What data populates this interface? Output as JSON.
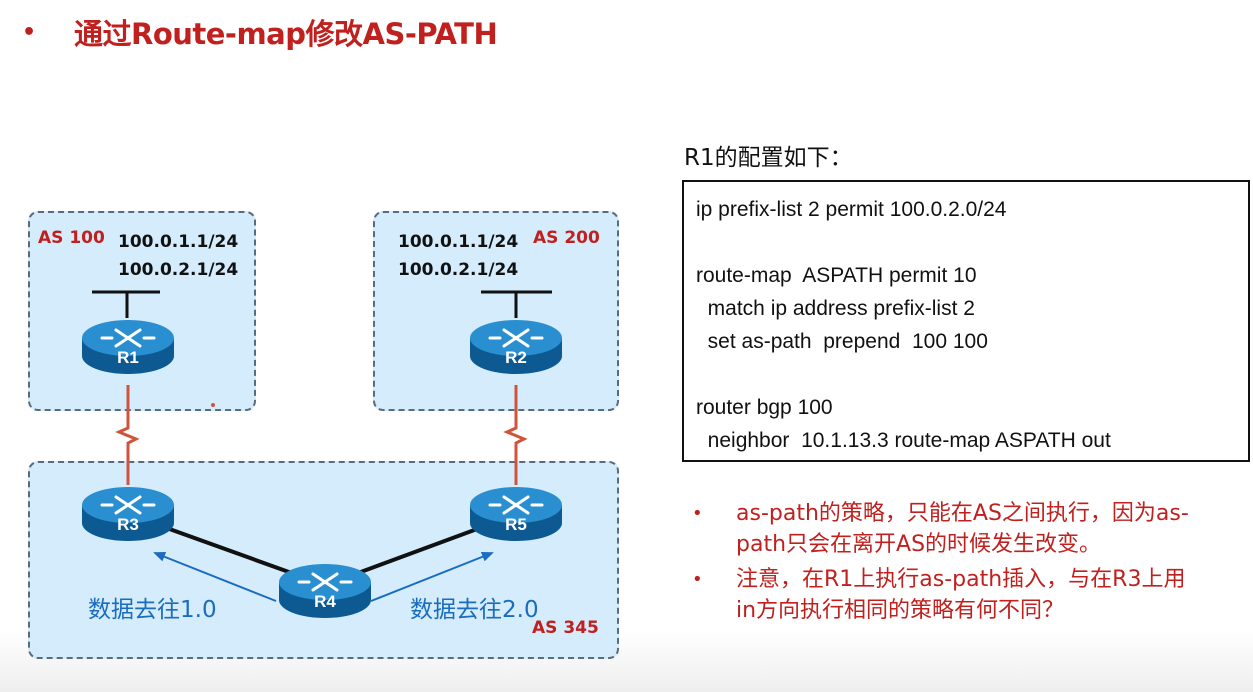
{
  "title": {
    "bullet": "•",
    "text": "通过Route-map修改AS-PATH"
  },
  "diagram": {
    "as_boxes": [
      {
        "id": "as100",
        "label": "AS 100",
        "addresses": [
          "100.0.1.1/24",
          "100.0.2.1/24"
        ]
      },
      {
        "id": "as200",
        "label": "AS 200",
        "addresses": [
          "100.0.1.1/24",
          "100.0.2.1/24"
        ]
      },
      {
        "id": "as345",
        "label": "AS 345"
      }
    ],
    "routers": [
      "R1",
      "R2",
      "R3",
      "R4",
      "R5"
    ],
    "flows": [
      "数据去往1.0",
      "数据去往2.0"
    ],
    "colors": {
      "box_fill": "#d4ecfb",
      "router_body": "#1e7fc1",
      "serial_link": "#d0533c",
      "flow_arrow": "#1a6cbf",
      "accent_red": "#c0201e"
    }
  },
  "config": {
    "title": "R1的配置如下：",
    "lines": [
      "ip prefix-list 2 permit 100.0.2.0/24",
      "",
      "route-map  ASPATH permit 10",
      "  match ip address prefix-list 2",
      "  set as-path  prepend  100 100",
      "",
      "router bgp 100",
      "  neighbor  10.1.13.3 route-map ASPATH out"
    ]
  },
  "notes": [
    {
      "bullet": "•",
      "text": "as-path的策略，只能在AS之间执行，因为as-path只会在离开AS的时候发生改变。"
    },
    {
      "bullet": "•",
      "text": "注意，在R1上执行as-path插入，与在R3上用in方向执行相同的策略有何不同？"
    }
  ]
}
